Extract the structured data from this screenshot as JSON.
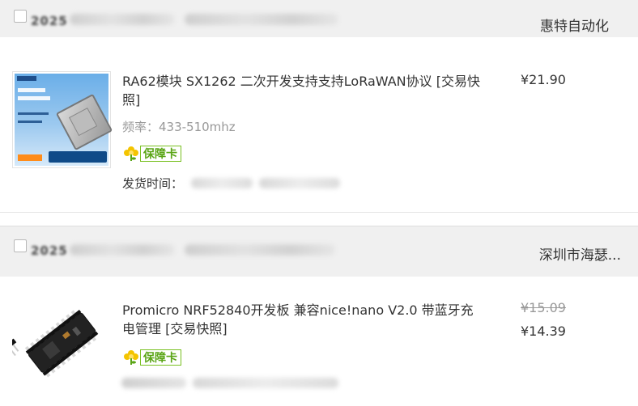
{
  "orders": [
    {
      "date_prefix": "2025",
      "shop": "惠特自动化",
      "item": {
        "title": "RA62模块 SX1262 二次开发支持支持LoRaWAN协议 [交易快照]",
        "attribute": "频率：433-510mhz",
        "guarantee_badge": "保障卡",
        "ship_label": "发货时间：",
        "price": "¥21.90"
      }
    },
    {
      "date_prefix": "2025",
      "shop": "深圳市海瑟...",
      "item": {
        "title": "Promicro NRF52840开发板 兼容nice!nano V2.0 带蓝牙充电管理 [交易快照]",
        "guarantee_badge": "保障卡",
        "original_price": "¥15.09",
        "price": "¥14.39"
      }
    }
  ],
  "colors": {
    "header_bg": "#f0f0f0",
    "muted_text": "#999999",
    "badge_green": "#5aa516"
  },
  "icons": [
    "checkbox",
    "guarantee-flower-icon",
    "product-thumbnail"
  ]
}
